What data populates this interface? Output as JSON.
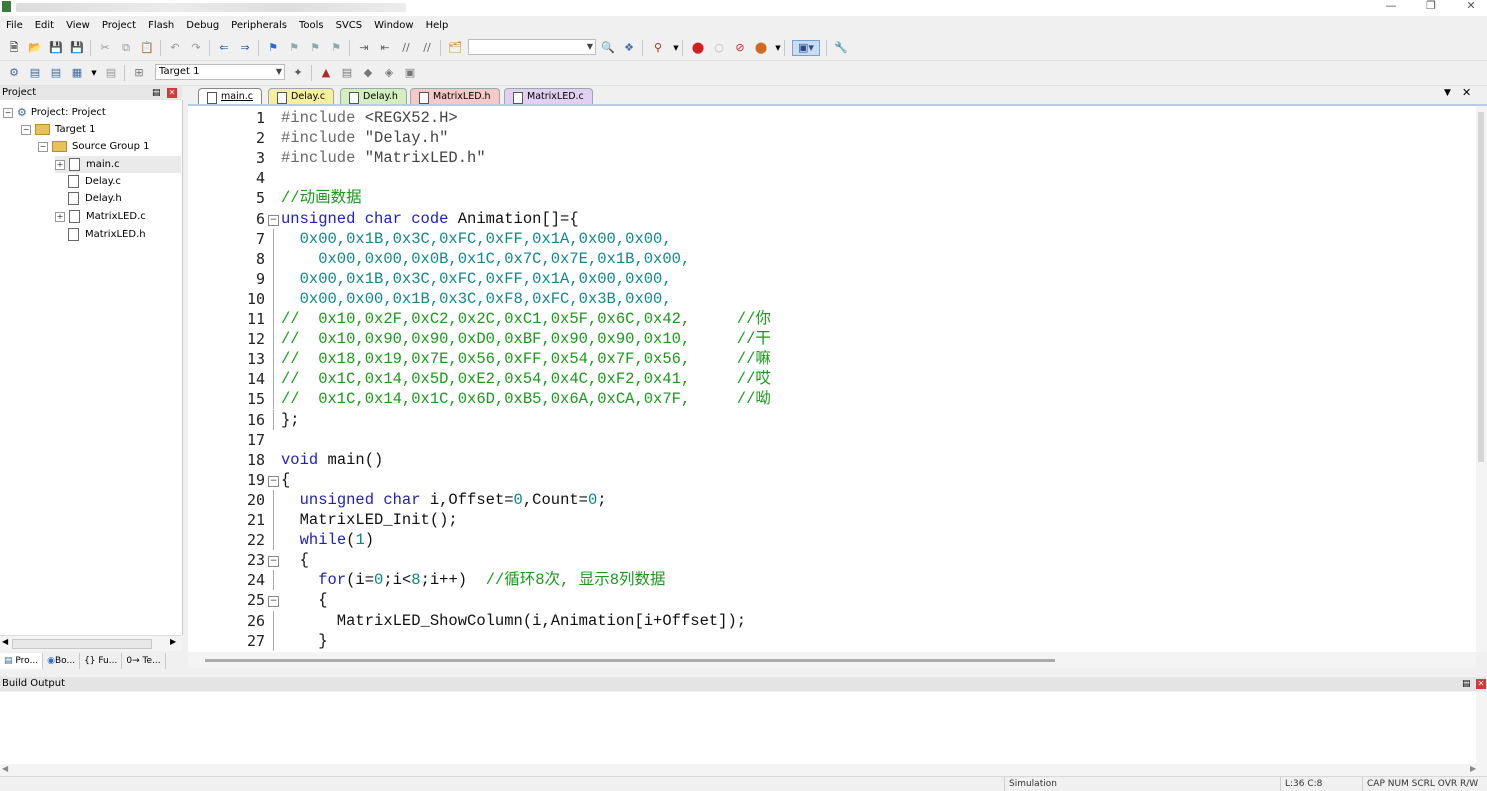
{
  "menu": [
    "File",
    "Edit",
    "View",
    "Project",
    "Flash",
    "Debug",
    "Peripherals",
    "Tools",
    "SVCS",
    "Window",
    "Help"
  ],
  "toolbar2": {
    "target": "Target 1"
  },
  "project_panel": {
    "title": "Project",
    "tree": {
      "root": "Project: Project",
      "target": "Target 1",
      "group": "Source Group 1",
      "files": [
        "main.c",
        "Delay.c",
        "Delay.h",
        "MatrixLED.c",
        "MatrixLED.h"
      ]
    },
    "bottom_tabs": [
      "Pro...",
      "Bo...",
      "{} Fu...",
      "0→ Te..."
    ]
  },
  "editor_tabs": [
    {
      "label": "main.c",
      "color": "#f0f0f0"
    },
    {
      "label": "Delay.c",
      "color": "#f7ef9c"
    },
    {
      "label": "Delay.h",
      "color": "#d4eec0"
    },
    {
      "label": "MatrixLED.h",
      "color": "#f7c8c8"
    },
    {
      "label": "MatrixLED.c",
      "color": "#e2d0f2"
    }
  ],
  "code": {
    "line_numbers": [
      "1",
      "2",
      "3",
      "4",
      "5",
      "6",
      "7",
      "8",
      "9",
      "10",
      "11",
      "12",
      "13",
      "14",
      "15",
      "16",
      "17",
      "18",
      "19",
      "20",
      "21",
      "22",
      "23",
      "24",
      "25",
      "26",
      "27"
    ],
    "lines": [
      [
        [
          "pre",
          "#include "
        ],
        [
          "str",
          "<REGX52.H>"
        ]
      ],
      [
        [
          "pre",
          "#include "
        ],
        [
          "str",
          "\"Delay.h\""
        ]
      ],
      [
        [
          "pre",
          "#include "
        ],
        [
          "str",
          "\"MatrixLED.h\""
        ]
      ],
      [],
      [
        [
          "cm",
          "//动画数据"
        ]
      ],
      [
        [
          "kw",
          "unsigned char code"
        ],
        [
          "pl",
          " Animation[]={"
        ]
      ],
      [
        [
          "hex",
          "  0x00,0x1B,0x3C,0xFC,0xFF,0x1A,0x00,0x00,"
        ]
      ],
      [
        [
          "hex",
          "    0x00,0x00,0x0B,0x1C,0x7C,0x7E,0x1B,0x00,"
        ]
      ],
      [
        [
          "hex",
          "  0x00,0x1B,0x3C,0xFC,0xFF,0x1A,0x00,0x00,"
        ]
      ],
      [
        [
          "hex",
          "  0x00,0x00,0x1B,0x3C,0xF8,0xFC,0x3B,0x00,"
        ]
      ],
      [
        [
          "cm",
          "//  0x10,0x2F,0xC2,0x2C,0xC1,0x5F,0x6C,0x42,     //你"
        ]
      ],
      [
        [
          "cm",
          "//  0x10,0x90,0x90,0xD0,0xBF,0x90,0x90,0x10,     //干"
        ]
      ],
      [
        [
          "cm",
          "//  0x18,0x19,0x7E,0x56,0xFF,0x54,0x7F,0x56,     //嘛"
        ]
      ],
      [
        [
          "cm",
          "//  0x1C,0x14,0x5D,0xE2,0x54,0x4C,0xF2,0x41,     //哎"
        ]
      ],
      [
        [
          "cm",
          "//  0x1C,0x14,0x1C,0x6D,0xB5,0x6A,0xCA,0x7F,     //呦"
        ]
      ],
      [
        [
          "pl",
          "};"
        ]
      ],
      [],
      [
        [
          "kw",
          "void"
        ],
        [
          "pl",
          " main()"
        ]
      ],
      [
        [
          "pl",
          "{"
        ]
      ],
      [
        [
          "pl",
          "  "
        ],
        [
          "kw",
          "unsigned char"
        ],
        [
          "pl",
          " i,Offset="
        ],
        [
          "num",
          "0"
        ],
        [
          "pl",
          ",Count="
        ],
        [
          "num",
          "0"
        ],
        [
          "pl",
          ";"
        ]
      ],
      [
        [
          "pl",
          "  MatrixLED_Init();"
        ]
      ],
      [
        [
          "pl",
          "  "
        ],
        [
          "kw",
          "while"
        ],
        [
          "pl",
          "("
        ],
        [
          "num",
          "1"
        ],
        [
          "pl",
          ")"
        ]
      ],
      [
        [
          "pl",
          "  {"
        ]
      ],
      [
        [
          "pl",
          "    "
        ],
        [
          "kw",
          "for"
        ],
        [
          "pl",
          "(i="
        ],
        [
          "num",
          "0"
        ],
        [
          "pl",
          ";i<"
        ],
        [
          "num",
          "8"
        ],
        [
          "pl",
          ";i++)  "
        ],
        [
          "cm",
          "//循环8次, 显示8列数据"
        ]
      ],
      [
        [
          "pl",
          "    {"
        ]
      ],
      [
        [
          "pl",
          "      MatrixLED_ShowColumn(i,Animation[i+Offset]);"
        ]
      ],
      [
        [
          "pl",
          "    }"
        ]
      ]
    ]
  },
  "build_output": {
    "title": "Build Output"
  },
  "status": {
    "mode": "Simulation",
    "position": "L:36 C:8",
    "flags": "CAP NUM SCRL OVR R/W"
  }
}
